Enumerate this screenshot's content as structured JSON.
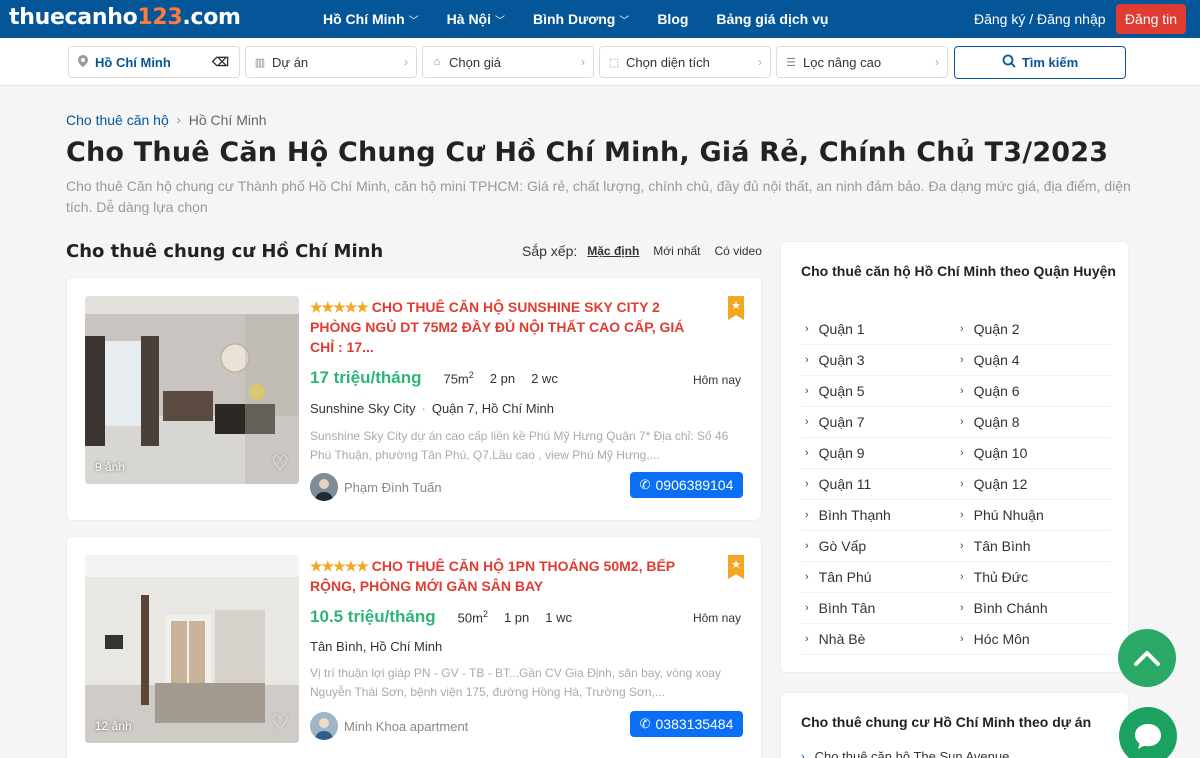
{
  "brand": {
    "logo_pre": "thuecanho",
    "logo_num": "123",
    "logo_post": ".com"
  },
  "nav": {
    "items": [
      {
        "label": "Hồ Chí Minh",
        "dropdown": true
      },
      {
        "label": "Hà Nội",
        "dropdown": true
      },
      {
        "label": "Bình Dương",
        "dropdown": true
      },
      {
        "label": "Blog",
        "dropdown": false
      },
      {
        "label": "Bảng giá dịch vụ",
        "dropdown": false
      }
    ],
    "auth_label": "Đăng ký / Đăng nhập",
    "post_label": "Đăng tin"
  },
  "filters": {
    "location": "Hồ Chí Minh",
    "project": "Dự án",
    "price": "Chọn giá",
    "area": "Chọn diện tích",
    "advanced": "Lọc nâng cao",
    "search_label": "Tìm kiếm"
  },
  "breadcrumb": {
    "root": "Cho thuê căn hộ",
    "current": "Hồ Chí Minh"
  },
  "page": {
    "title": "Cho Thuê Căn Hộ Chung Cư Hồ Chí Minh, Giá Rẻ, Chính Chủ T3/2023",
    "description": "Cho thuê Căn hộ chung cư Thành phố Hồ Chí Minh, căn hộ mini TPHCM: Giá rẻ, chất lượng, chính chủ, đầy đủ nội thất, an ninh đảm bảo. Đa dạng mức giá, địa điểm, diện tích. Dễ dàng lựa chọn"
  },
  "listing_section": {
    "title": "Cho thuê chung cư Hồ Chí Minh",
    "sort_label": "Sắp xếp:",
    "sort_options": [
      "Mặc định",
      "Mới nhất",
      "Có video"
    ]
  },
  "listings": [
    {
      "stars": "★★★★★",
      "title": "CHO THUÊ CĂN HỘ SUNSHINE SKY CITY 2 PHÒNG NGỦ DT 75M2 ĐẦY ĐỦ NỘI THẤT CAO CẤP, GIÁ CHỈ : 17...",
      "price": "17 triệu/tháng",
      "area": "75m",
      "area_sup": "2",
      "bedrooms": "2 pn",
      "bathrooms": "2 wc",
      "time": "Hôm nay",
      "project": "Sunshine Sky City",
      "address": "Quận 7, Hồ Chí Minh",
      "description": "Sunshine Sky City dự án cao cấp liền kề Phú Mỹ Hưng Quận 7* Địa chỉ: Số 46 Phú Thuận, phường Tân Phú, Q7.Lầu cao , view Phú Mỹ Hưng,...",
      "owner": "Phạm Đình Tuấn",
      "phone": "0906389104",
      "photo_count": "9 ảnh"
    },
    {
      "stars": "★★★★★",
      "title": "CHO THUÊ CĂN HỘ 1PN THOÁNG 50M2, BẾP RỘNG, PHÒNG MỚI GẦN SÂN BAY",
      "price": "10.5 triệu/tháng",
      "area": "50m",
      "area_sup": "2",
      "bedrooms": "1 pn",
      "bathrooms": "1 wc",
      "time": "Hôm nay",
      "address": "Tân Bình, Hồ Chí Minh",
      "description": "Vị trí thuận lợi giáp PN - GV - TB - BT...Gần CV Gia Định, sân bay, vòng xoay Nguyễn Thái Sơn, bệnh viện 175, đường Hồng Hà, Trường Sơn,...",
      "owner": "Minh Khoa apartment",
      "phone": "0383135484",
      "photo_count": "12 ảnh"
    }
  ],
  "sidebar": {
    "district_title": "Cho thuê căn hộ Hồ Chí Minh theo Quận Huyện",
    "districts": [
      "Quận 1",
      "Quận 2",
      "Quận 3",
      "Quận 4",
      "Quận 5",
      "Quận 6",
      "Quận 7",
      "Quận 8",
      "Quận 9",
      "Quận 10",
      "Quận 11",
      "Quận 12",
      "Bình Thạnh",
      "Phú Nhuận",
      "Gò Vấp",
      "Tân Bình",
      "Tân Phú",
      "Thủ Đức",
      "Bình Tân",
      "Bình Chánh",
      "Nhà Bè",
      "Hóc Môn"
    ],
    "project_title": "Cho thuê chung cư Hồ Chí Minh theo dự án",
    "project_first": "Cho thuê căn hộ The Sun Avenue"
  },
  "colors": {
    "primary": "#055699",
    "accent_red": "#e03c31",
    "price_green": "#2db674",
    "phone_blue": "#0a6ff5",
    "fab_green": "#2aa866"
  }
}
